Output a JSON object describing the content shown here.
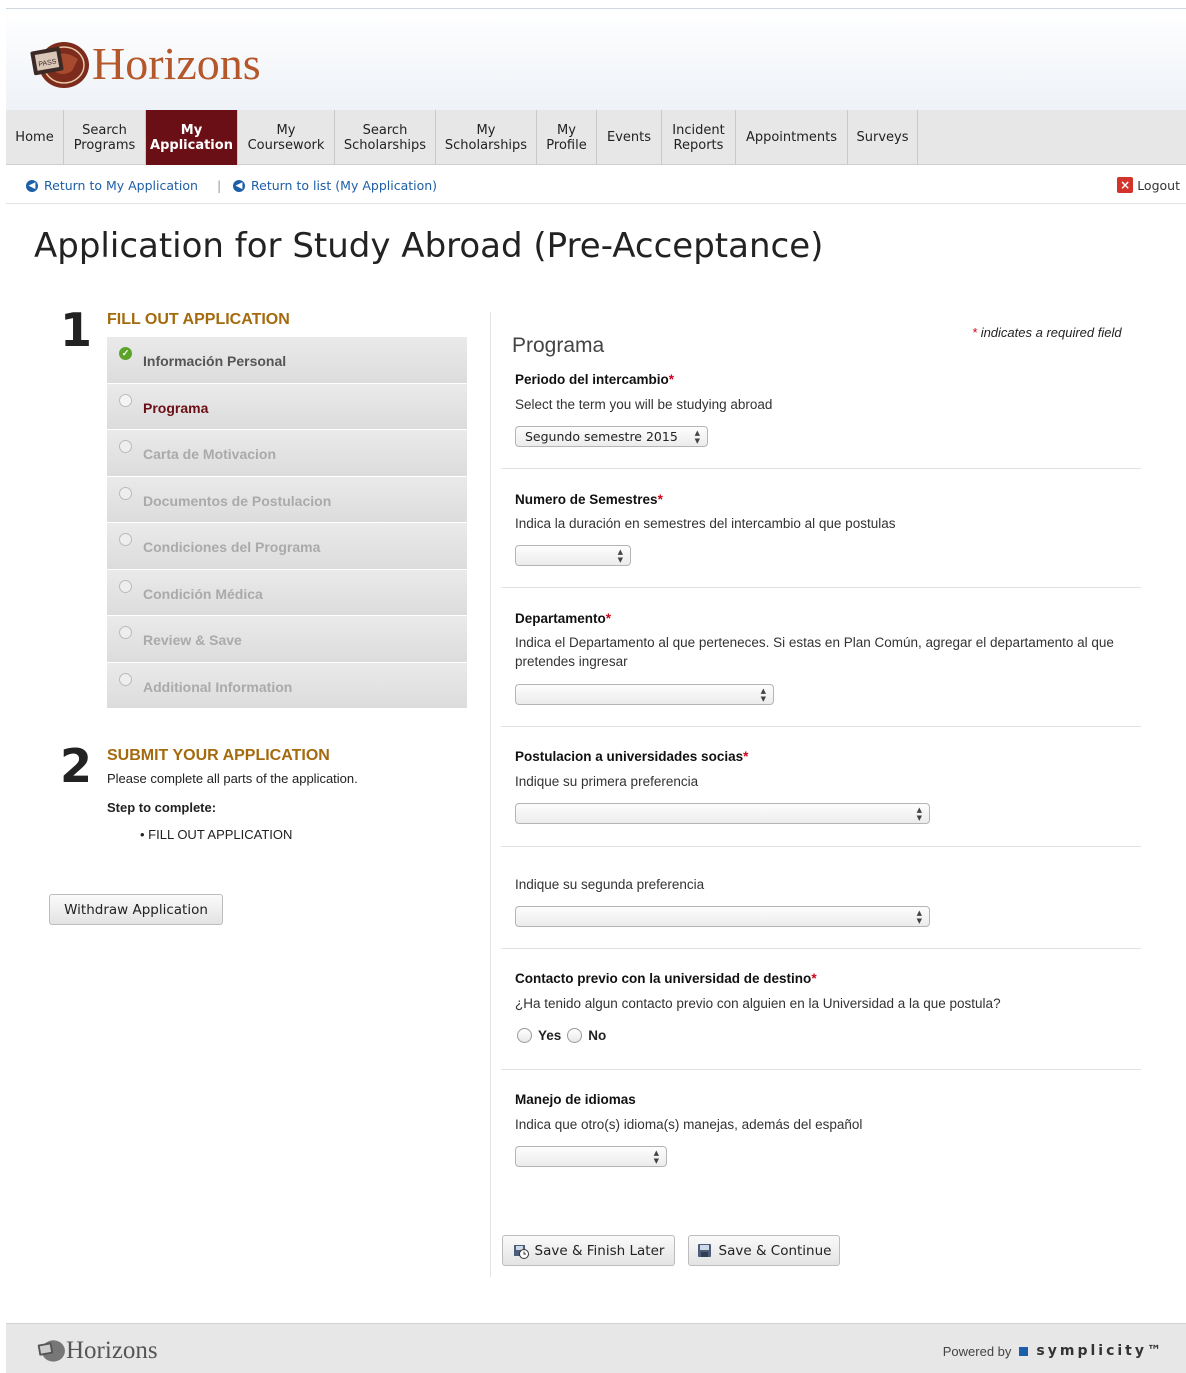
{
  "brand": {
    "name": "Horizons",
    "color": "#b4572b"
  },
  "nav": {
    "items": [
      {
        "label": "Home"
      },
      {
        "label": "Search\nPrograms"
      },
      {
        "label": "My\nApplication"
      },
      {
        "label": "My\nCoursework"
      },
      {
        "label": "Search\nScholarships"
      },
      {
        "label": "My\nScholarships"
      },
      {
        "label": "My\nProfile"
      },
      {
        "label": "Events"
      },
      {
        "label": "Incident\nReports"
      },
      {
        "label": "Appointments"
      },
      {
        "label": "Surveys"
      }
    ],
    "active_color": "#6b0f17"
  },
  "subbar": {
    "return_app": "Return to My Application",
    "separator": "|",
    "return_list": "Return to list (My Application)",
    "logout": "Logout"
  },
  "page_title": "Application for Study Abroad (Pre-Acceptance)",
  "left": {
    "step1_num": "1",
    "step1_title": "FILL OUT APPLICATION",
    "steps": [
      {
        "label": "Información Personal",
        "state": "done"
      },
      {
        "label": "Programa",
        "state": "current"
      },
      {
        "label": "Carta de Motivacion",
        "state": "todo"
      },
      {
        "label": "Documentos de Postulacion",
        "state": "todo"
      },
      {
        "label": "Condiciones del Programa",
        "state": "todo"
      },
      {
        "label": "Condición Médica",
        "state": "todo"
      },
      {
        "label": "Review & Save",
        "state": "todo"
      },
      {
        "label": "Additional Information",
        "state": "todo"
      }
    ],
    "step2_num": "2",
    "step2_title": "SUBMIT YOUR APPLICATION",
    "submit_note": "Please complete all parts of the application.",
    "step_to_complete_label": "Step to complete:",
    "step_to_complete_item": "FILL OUT APPLICATION",
    "withdraw_button": "Withdraw Application"
  },
  "form": {
    "required_note": "indicates a required field",
    "section_title": "Programa",
    "fields": {
      "periodo": {
        "label": "Periodo del intercambio",
        "help": "Select the term you will be studying abroad",
        "value": "Segundo semestre 2015"
      },
      "semestres": {
        "label": "Numero de Semestres",
        "help": "Indica la duración en semestres del intercambio al que postulas",
        "value": ""
      },
      "departamento": {
        "label": "Departamento",
        "help": "Indica el Departamento al que perteneces. Si estas en Plan Común, agregar el departamento al que pretendes ingresar",
        "value": ""
      },
      "postulacion": {
        "label": "Postulacion a universidades socias",
        "help": "Indique su primera preferencia",
        "value": ""
      },
      "segunda": {
        "help": "Indique su segunda preferencia",
        "value": ""
      },
      "contacto": {
        "label": "Contacto previo con la universidad de destino",
        "help": "¿Ha tenido algun contacto previo con alguien en la Universidad a la que postula?",
        "yes": "Yes",
        "no": "No"
      },
      "idiomas": {
        "label": "Manejo de idiomas",
        "help": "Indica que otro(s) idioma(s) manejas, además del español",
        "value": ""
      }
    },
    "save_finish_later": "Save & Finish Later",
    "save_continue": "Save & Continue"
  },
  "footer": {
    "brand": "Horizons",
    "powered_by": "Powered by",
    "symplicity": "symplicity™"
  }
}
